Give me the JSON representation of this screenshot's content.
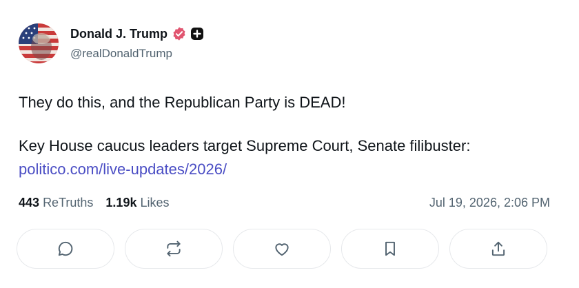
{
  "author": {
    "display_name": "Donald J. Trump",
    "handle": "@realDonaldTrump",
    "avatar_icon": "flag-portrait-avatar",
    "verified_icon": "verified-badge-icon",
    "plus_icon": "plus-badge-icon"
  },
  "post": {
    "line1": "They do this, and the Republican Party is DEAD!",
    "line2_text": "Key House caucus leaders target Supreme Court, Senate filibuster: ",
    "line2_link": "politico.com/live-updates/2026/"
  },
  "stats": {
    "retruths_count": "443",
    "retruths_label": "ReTruths",
    "likes_count": "1.19k",
    "likes_label": "Likes",
    "timestamp": "Jul 19, 2026, 2:06 PM"
  },
  "actions": [
    {
      "icon": "reply-icon"
    },
    {
      "icon": "retruth-icon"
    },
    {
      "icon": "like-icon"
    },
    {
      "icon": "bookmark-icon"
    },
    {
      "icon": "share-icon"
    }
  ],
  "colors": {
    "accent": "#4a4dc4",
    "verified": "#e15570",
    "muted": "#536471",
    "border": "#e6e8eb"
  }
}
